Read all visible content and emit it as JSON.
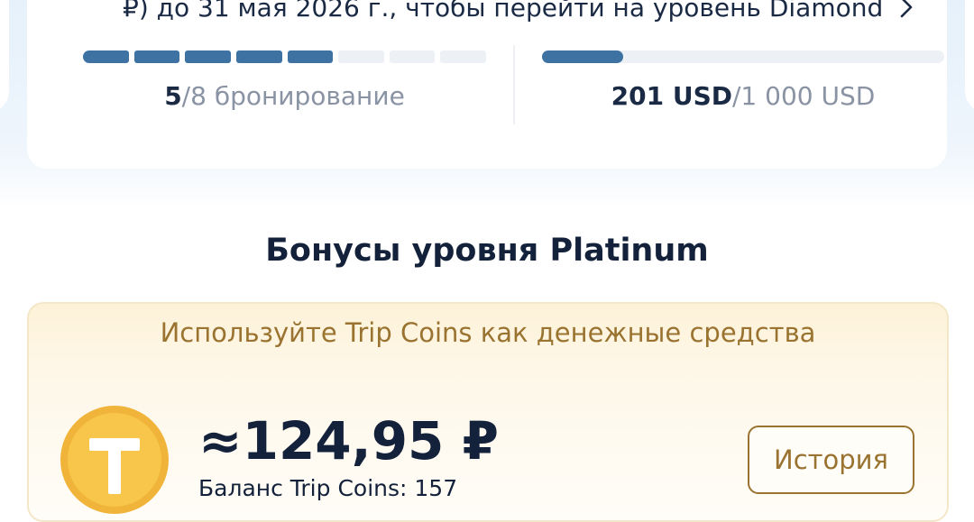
{
  "tier_progress": {
    "upgrade_text": "₽) до 31 мая 2026 г., чтобы перейти на уровень Diamond",
    "bookings": {
      "current": "5",
      "total_label": "/8 бронирование",
      "completed": 5,
      "required": 8
    },
    "spend": {
      "current": "201 USD",
      "total_label": "/1 000 USD",
      "fraction": 0.201
    }
  },
  "section_title": "Бонусы уровня Platinum",
  "coins_card": {
    "heading": "Используйте Trip Coins как денежные средства",
    "amount": "≈124,95 ₽",
    "balance": "Баланс Trip Coins: 157",
    "history_label": "История",
    "coin_icon": "trip-coin-icon",
    "coin_letter": "T"
  },
  "colors": {
    "progress": "#3d72a3",
    "gold_text": "#9a7330",
    "dark_text": "#13213a"
  }
}
